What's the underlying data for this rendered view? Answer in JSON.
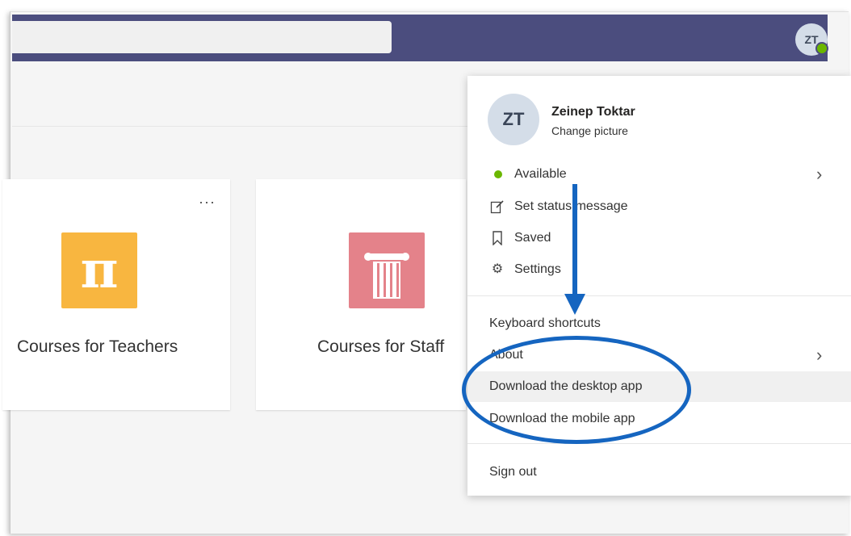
{
  "topbar": {
    "avatar_initials": "ZT",
    "presence": "available"
  },
  "cards": [
    {
      "title": "Courses for Teachers",
      "icon": "pi-icon",
      "icon_color": "#f8b640",
      "more": "···"
    },
    {
      "title": "Courses for Staff",
      "icon": "column-icon",
      "icon_color": "#e4828a"
    }
  ],
  "profile_menu": {
    "initials": "ZT",
    "name": "Zeinep Toktar",
    "change_picture": "Change picture",
    "status": "Available",
    "set_status": "Set status message",
    "saved": "Saved",
    "settings": "Settings",
    "keyboard_shortcuts": "Keyboard shortcuts",
    "about": "About",
    "download_desktop": "Download the desktop app",
    "download_mobile": "Download the mobile app",
    "sign_out": "Sign out"
  },
  "colors": {
    "topbar": "#4b4d7e",
    "presence_available": "#6bb700",
    "annotation": "#1565c0"
  }
}
